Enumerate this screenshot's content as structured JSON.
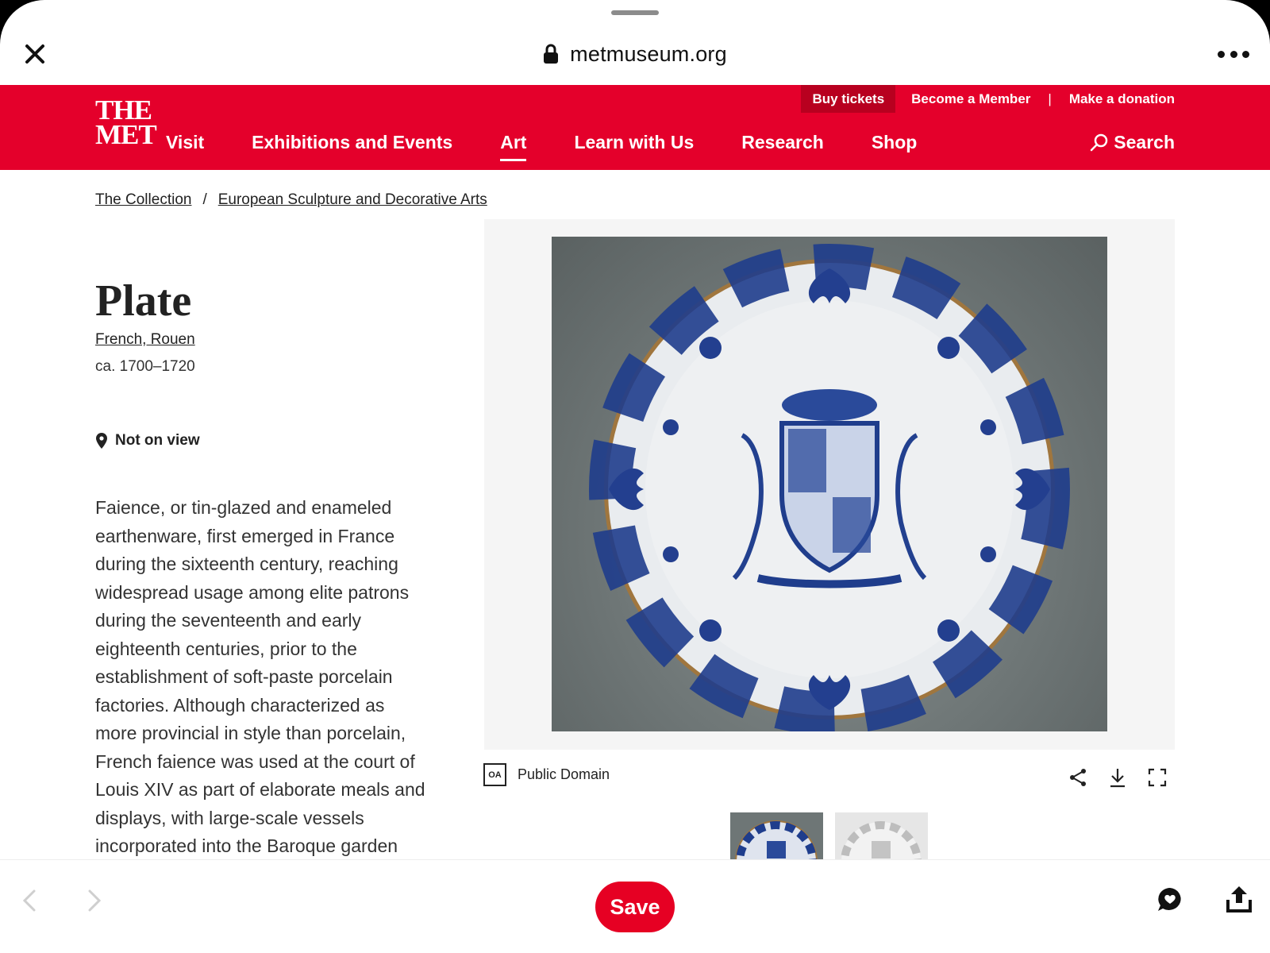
{
  "browser": {
    "url": "metmuseum.org",
    "close_icon": "close-icon",
    "lock_icon": "lock-icon",
    "more_icon": "ellipsis-icon"
  },
  "header": {
    "logo_line1": "THE",
    "logo_line2": "MET",
    "utility": {
      "buy_tickets": "Buy tickets",
      "become_member": "Become a Member",
      "separator": "|",
      "make_donation": "Make a donation"
    },
    "nav": [
      {
        "label": "Visit"
      },
      {
        "label": "Exhibitions and Events"
      },
      {
        "label": "Art",
        "active": true
      },
      {
        "label": "Learn with Us"
      },
      {
        "label": "Research"
      },
      {
        "label": "Shop"
      }
    ],
    "search_label": "Search",
    "brand_color": "#e4002b"
  },
  "breadcrumb": {
    "item1": "The Collection",
    "separator": "/",
    "item2": "European Sculpture and Decorative Arts"
  },
  "object": {
    "title": "Plate",
    "culture": "French, Rouen",
    "date": "ca. 1700–1720",
    "on_view": "Not on view",
    "description": "Faience, or tin-glazed and enameled earthenware, first emerged in France during the sixteenth century, reaching widespread usage among elite patrons during the seventeenth and early eighteenth centuries, prior to the establishment of soft-paste porcelain factories. Although characterized as more provincial in style than porcelain, French faience was used at the court of Louis XIV as part of elaborate meals and displays, with large-scale vessels incorporated into the Baroque garden"
  },
  "image": {
    "rights_badge": "OA",
    "rights_label": "Public Domain",
    "actions": [
      "share-icon",
      "download-icon",
      "fullscreen-icon"
    ]
  },
  "toolbar": {
    "save_label": "Save",
    "save_color": "#e60023"
  }
}
